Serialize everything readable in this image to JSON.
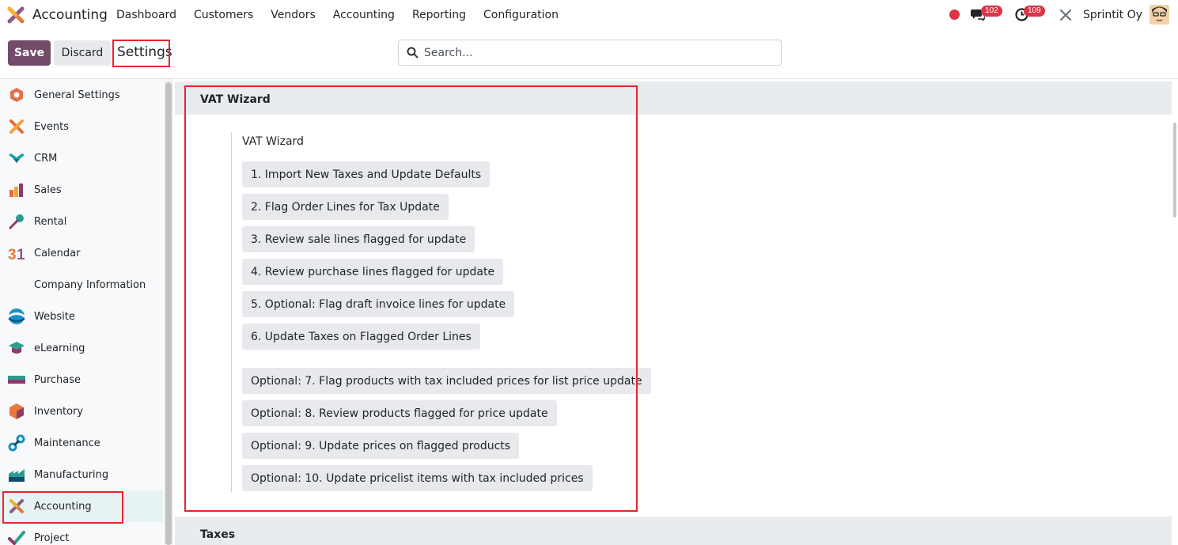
{
  "topbar": {
    "app_title": "Accounting",
    "menu": [
      "Dashboard",
      "Customers",
      "Vendors",
      "Accounting",
      "Reporting",
      "Configuration"
    ],
    "messages_badge": "102",
    "activities_badge": "109",
    "company": "Sprintit Oy"
  },
  "controlbar": {
    "save_label": "Save",
    "discard_label": "Discard",
    "page_title": "Settings",
    "search_placeholder": "Search..."
  },
  "sidebar": {
    "items": [
      {
        "label": "General Settings",
        "icon": "general-settings-icon"
      },
      {
        "label": "Events",
        "icon": "events-icon"
      },
      {
        "label": "CRM",
        "icon": "crm-icon"
      },
      {
        "label": "Sales",
        "icon": "sales-icon"
      },
      {
        "label": "Rental",
        "icon": "rental-icon"
      },
      {
        "label": "Calendar",
        "icon": "calendar-icon"
      },
      {
        "label": "Company Information",
        "icon": ""
      },
      {
        "label": "Website",
        "icon": "website-icon"
      },
      {
        "label": "eLearning",
        "icon": "elearning-icon"
      },
      {
        "label": "Purchase",
        "icon": "purchase-icon"
      },
      {
        "label": "Inventory",
        "icon": "inventory-icon"
      },
      {
        "label": "Maintenance",
        "icon": "maintenance-icon"
      },
      {
        "label": "Manufacturing",
        "icon": "manufacturing-icon"
      },
      {
        "label": "Accounting",
        "icon": "accounting-icon"
      },
      {
        "label": "Project",
        "icon": "project-icon"
      }
    ],
    "active": "Accounting"
  },
  "main": {
    "section_title": "VAT Wizard",
    "wizard_label": "VAT Wizard",
    "buttons": [
      "1. Import New Taxes and Update Defaults",
      "2. Flag Order Lines for Tax Update",
      "3. Review sale lines flagged for update",
      "4. Review purchase lines flagged for update",
      "5. Optional: Flag draft invoice lines for update",
      "6. Update Taxes on Flagged Order Lines",
      "Optional: 7. Flag products with tax included prices for list price update",
      "Optional: 8. Review products flagged for price update",
      "Optional: 9. Update prices on flagged products",
      "Optional: 10. Update pricelist items with tax included prices"
    ],
    "next_section_title": "Taxes"
  },
  "colors": {
    "brand": "#714b67",
    "highlight": "#e5262b",
    "badge": "#dc3545"
  }
}
